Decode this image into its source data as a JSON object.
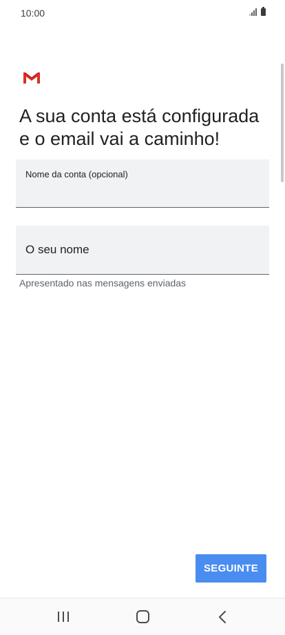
{
  "status_bar": {
    "time": "10:00",
    "signal_icon": "signal-icon",
    "battery_icon": "battery-icon"
  },
  "logo": {
    "icon": "gmail-icon",
    "colors": [
      "#d93025",
      "#c5221f"
    ]
  },
  "heading": "A sua conta está configurada e o email vai a caminho!",
  "account_field": {
    "label": "Nome da conta (opcional)",
    "value": ""
  },
  "name_field": {
    "placeholder": "O seu nome",
    "value": "",
    "helper": "Apresentado nas mensagens enviadas"
  },
  "next_button": {
    "label": "SEGUINTE",
    "color": "#4a8df0"
  },
  "nav_bar": {
    "recent_icon": "recent-apps-icon",
    "home_icon": "home-icon",
    "back_icon": "back-icon"
  }
}
